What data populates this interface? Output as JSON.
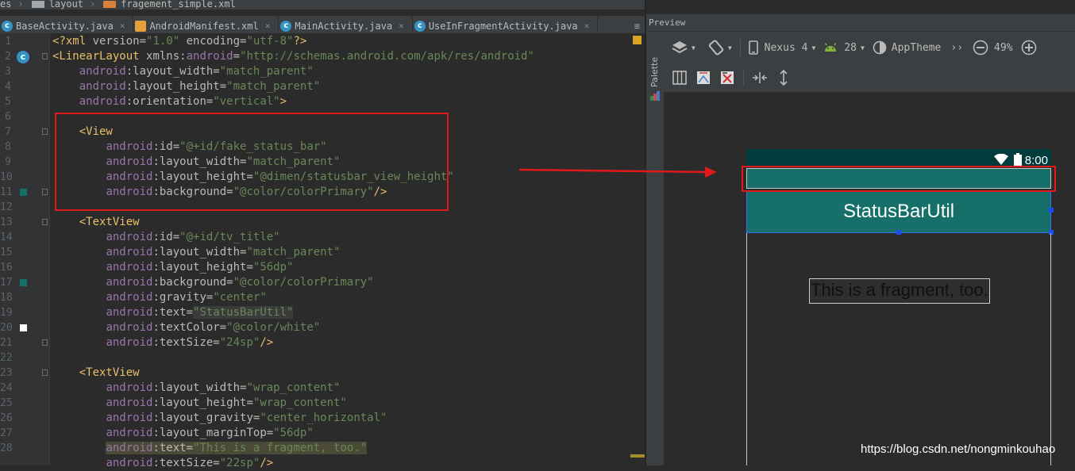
{
  "breadcrumb": [
    "es",
    "layout",
    "fragement_simple.xml"
  ],
  "tabs": [
    {
      "label": "BaseActivity.java",
      "icon": "class-icon"
    },
    {
      "label": "AndroidManifest.xml",
      "icon": "manifest-icon"
    },
    {
      "label": "MainActivity.java",
      "icon": "class-icon"
    },
    {
      "label": "UseInFragmentActivity.java",
      "icon": "class-icon"
    }
  ],
  "tab_menu": "≡",
  "editor": {
    "lines": [
      {
        "n": "1",
        "tokens": [
          [
            "xml",
            "<?xml "
          ],
          [
            "attr",
            "version="
          ],
          [
            "str",
            "\"1.0\" "
          ],
          [
            "attr",
            "encoding="
          ],
          [
            "str",
            "\"utf-8\""
          ],
          [
            "xml",
            "?>"
          ]
        ]
      },
      {
        "n": "2",
        "tokens": [
          [
            "tag",
            "<LinearLayout "
          ],
          [
            "attr",
            "xmlns:"
          ],
          [
            "ns",
            "android"
          ],
          [
            "attr",
            "="
          ],
          [
            "str",
            "\"http://schemas.android.com/apk/res/android\""
          ]
        ]
      },
      {
        "n": "3",
        "tokens": [
          [
            "pad",
            "    "
          ],
          [
            "ns",
            "android"
          ],
          [
            "attr",
            ":layout_width="
          ],
          [
            "str",
            "\"match_parent\""
          ]
        ]
      },
      {
        "n": "4",
        "tokens": [
          [
            "pad",
            "    "
          ],
          [
            "ns",
            "android"
          ],
          [
            "attr",
            ":layout_height="
          ],
          [
            "str",
            "\"match_parent\""
          ]
        ]
      },
      {
        "n": "5",
        "tokens": [
          [
            "pad",
            "    "
          ],
          [
            "ns",
            "android"
          ],
          [
            "attr",
            ":orientation="
          ],
          [
            "str",
            "\"vertical\""
          ],
          [
            "tag",
            ">"
          ]
        ]
      },
      {
        "n": "6",
        "tokens": []
      },
      {
        "n": "7",
        "tokens": [
          [
            "pad",
            "    "
          ],
          [
            "tag",
            "<View"
          ]
        ]
      },
      {
        "n": "8",
        "tokens": [
          [
            "pad",
            "        "
          ],
          [
            "ns",
            "android"
          ],
          [
            "attr",
            ":id="
          ],
          [
            "str",
            "\"@+id/fake_status_bar\""
          ]
        ]
      },
      {
        "n": "9",
        "tokens": [
          [
            "pad",
            "        "
          ],
          [
            "ns",
            "android"
          ],
          [
            "attr",
            ":layout_width="
          ],
          [
            "str",
            "\"match_parent\""
          ]
        ]
      },
      {
        "n": "10",
        "tokens": [
          [
            "pad",
            "        "
          ],
          [
            "ns",
            "android"
          ],
          [
            "attr",
            ":layout_height="
          ],
          [
            "str",
            "\"@dimen/statusbar_view_height\""
          ]
        ]
      },
      {
        "n": "11",
        "tokens": [
          [
            "pad",
            "        "
          ],
          [
            "ns",
            "android"
          ],
          [
            "attr",
            ":background="
          ],
          [
            "str",
            "\"@color/colorPrimary\""
          ],
          [
            "tag",
            "/>"
          ]
        ]
      },
      {
        "n": "12",
        "tokens": []
      },
      {
        "n": "13",
        "tokens": [
          [
            "pad",
            "    "
          ],
          [
            "tag",
            "<TextView"
          ]
        ]
      },
      {
        "n": "14",
        "tokens": [
          [
            "pad",
            "        "
          ],
          [
            "ns",
            "android"
          ],
          [
            "attr",
            ":id="
          ],
          [
            "str",
            "\"@+id/tv_title\""
          ]
        ]
      },
      {
        "n": "15",
        "tokens": [
          [
            "pad",
            "        "
          ],
          [
            "ns",
            "android"
          ],
          [
            "attr",
            ":layout_width="
          ],
          [
            "str",
            "\"match_parent\""
          ]
        ]
      },
      {
        "n": "16",
        "tokens": [
          [
            "pad",
            "        "
          ],
          [
            "ns",
            "android"
          ],
          [
            "attr",
            ":layout_height="
          ],
          [
            "str",
            "\"56dp\""
          ]
        ]
      },
      {
        "n": "17",
        "tokens": [
          [
            "pad",
            "        "
          ],
          [
            "ns",
            "android"
          ],
          [
            "attr",
            ":background="
          ],
          [
            "str",
            "\"@color/colorPrimary\""
          ]
        ]
      },
      {
        "n": "18",
        "tokens": [
          [
            "pad",
            "        "
          ],
          [
            "ns",
            "android"
          ],
          [
            "attr",
            ":gravity="
          ],
          [
            "str",
            "\"center\""
          ]
        ]
      },
      {
        "n": "19",
        "tokens": [
          [
            "pad",
            "        "
          ],
          [
            "ns",
            "android"
          ],
          [
            "attr",
            ":text="
          ],
          [
            "strhl",
            "\"StatusBarUtil\""
          ]
        ]
      },
      {
        "n": "20",
        "tokens": [
          [
            "pad",
            "        "
          ],
          [
            "ns",
            "android"
          ],
          [
            "attr",
            ":textColor="
          ],
          [
            "str",
            "\"@color/white\""
          ]
        ]
      },
      {
        "n": "21",
        "tokens": [
          [
            "pad",
            "        "
          ],
          [
            "ns",
            "android"
          ],
          [
            "attr",
            ":textSize="
          ],
          [
            "str",
            "\"24sp\""
          ],
          [
            "tag",
            "/>"
          ]
        ]
      },
      {
        "n": "22",
        "tokens": []
      },
      {
        "n": "23",
        "tokens": [
          [
            "pad",
            "    "
          ],
          [
            "tag",
            "<TextView"
          ]
        ]
      },
      {
        "n": "24",
        "tokens": [
          [
            "pad",
            "        "
          ],
          [
            "ns",
            "android"
          ],
          [
            "attr",
            ":layout_width="
          ],
          [
            "str",
            "\"wrap_content\""
          ]
        ]
      },
      {
        "n": "25",
        "tokens": [
          [
            "pad",
            "        "
          ],
          [
            "ns",
            "android"
          ],
          [
            "attr",
            ":layout_height="
          ],
          [
            "str",
            "\"wrap_content\""
          ]
        ]
      },
      {
        "n": "26",
        "tokens": [
          [
            "pad",
            "        "
          ],
          [
            "ns",
            "android"
          ],
          [
            "attr",
            ":layout_gravity="
          ],
          [
            "str",
            "\"center_horizontal\""
          ]
        ]
      },
      {
        "n": "27",
        "tokens": [
          [
            "pad",
            "        "
          ],
          [
            "ns",
            "android"
          ],
          [
            "attr",
            ":layout_marginTop="
          ],
          [
            "str",
            "\"56dp\""
          ]
        ]
      },
      {
        "n": "28",
        "tokens": [
          [
            "pad",
            "        "
          ],
          [
            "nshl",
            "android"
          ],
          [
            "attrhl",
            ":text="
          ],
          [
            "strhl2",
            "\"This is a fragment, too.\""
          ]
        ]
      },
      {
        "n": "",
        "tokens": [
          [
            "pad",
            "        "
          ],
          [
            "ns",
            "android"
          ],
          [
            "attr",
            ":textSize="
          ],
          [
            "str",
            "\"22sp\""
          ],
          [
            "tag",
            "/>"
          ]
        ]
      }
    ]
  },
  "preview": {
    "panel_title": "Preview",
    "palette_label": "Palette",
    "device": "Nexus 4",
    "api_level": "28",
    "theme": "AppTheme",
    "more": "››",
    "zoom": "49%",
    "status_time": "8:00",
    "title_text": "StatusBarUtil",
    "fragment_text": "This is a fragment, too."
  },
  "colors": {
    "primary": "#167069",
    "status_bar": "#003c3b",
    "highlight_box": "#e0191c"
  },
  "watermark": "https://blog.csdn.net/nongminkouhao"
}
